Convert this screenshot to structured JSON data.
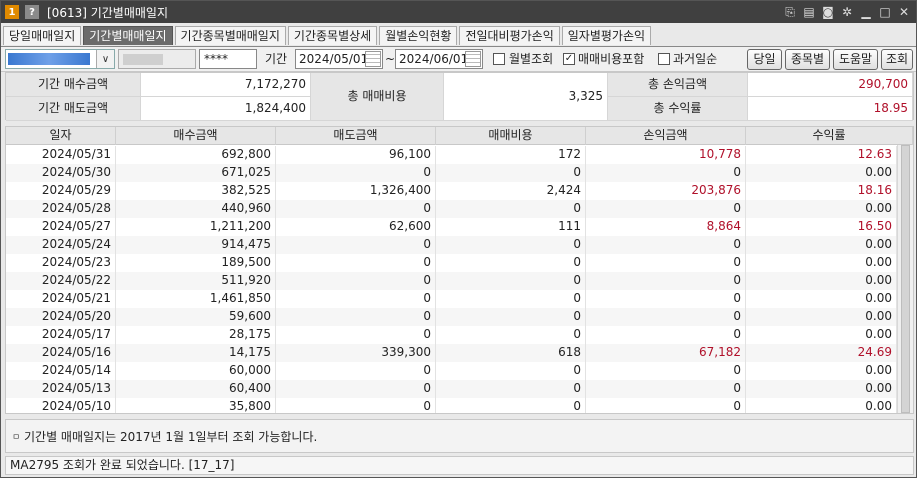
{
  "window": {
    "badge_one": "1",
    "badge_q": "?",
    "title": "[0613] 기간별매매일지"
  },
  "tabs": [
    {
      "label": "당일매매일지",
      "active": false
    },
    {
      "label": "기간별매매일지",
      "active": true
    },
    {
      "label": "기간종목별매매일지",
      "active": false
    },
    {
      "label": "기간종목별상세",
      "active": false
    },
    {
      "label": "월별손익현황",
      "active": false
    },
    {
      "label": "전일대비평가손익",
      "active": false
    },
    {
      "label": "일자별평가손익",
      "active": false
    }
  ],
  "filter": {
    "password": "****",
    "period_label": "기간",
    "start_date": "2024/05/01",
    "tilde": "~",
    "end_date": "2024/06/01",
    "monthly_label": "월별조회",
    "monthly_checked": false,
    "include_fee_label": "매매비용포함",
    "include_fee_checked": true,
    "past_order_label": "과거일순",
    "past_order_checked": false,
    "btn_today": "당일",
    "btn_by_stock": "종목별",
    "btn_help": "도움말",
    "btn_query": "조회"
  },
  "summary": {
    "buy_label": "기간 매수금액",
    "buy_value": "7,172,270",
    "sell_label": "기간 매도금액",
    "sell_value": "1,824,400",
    "fee_label": "총 매매비용",
    "fee_value": "3,325",
    "pnl_label": "총 손익금액",
    "pnl_value": "290,700",
    "return_label": "총 수익률",
    "return_value": "18.95"
  },
  "grid": {
    "headers": [
      "일자",
      "매수금액",
      "매도금액",
      "매매비용",
      "손익금액",
      "수익률"
    ],
    "rows": [
      [
        "2024/05/31",
        "692,800",
        "96,100",
        "172",
        "10,778",
        "12.63"
      ],
      [
        "2024/05/30",
        "671,025",
        "0",
        "0",
        "0",
        "0.00"
      ],
      [
        "2024/05/29",
        "382,525",
        "1,326,400",
        "2,424",
        "203,876",
        "18.16"
      ],
      [
        "2024/05/28",
        "440,960",
        "0",
        "0",
        "0",
        "0.00"
      ],
      [
        "2024/05/27",
        "1,211,200",
        "62,600",
        "111",
        "8,864",
        "16.50"
      ],
      [
        "2024/05/24",
        "914,475",
        "0",
        "0",
        "0",
        "0.00"
      ],
      [
        "2024/05/23",
        "189,500",
        "0",
        "0",
        "0",
        "0.00"
      ],
      [
        "2024/05/22",
        "511,920",
        "0",
        "0",
        "0",
        "0.00"
      ],
      [
        "2024/05/21",
        "1,461,850",
        "0",
        "0",
        "0",
        "0.00"
      ],
      [
        "2024/05/20",
        "59,600",
        "0",
        "0",
        "0",
        "0.00"
      ],
      [
        "2024/05/17",
        "28,175",
        "0",
        "0",
        "0",
        "0.00"
      ],
      [
        "2024/05/16",
        "14,175",
        "339,300",
        "618",
        "67,182",
        "24.69"
      ],
      [
        "2024/05/14",
        "60,000",
        "0",
        "0",
        "0",
        "0.00"
      ],
      [
        "2024/05/13",
        "60,400",
        "0",
        "0",
        "0",
        "0.00"
      ],
      [
        "2024/05/10",
        "35,800",
        "0",
        "0",
        "0",
        "0.00"
      ]
    ]
  },
  "notice": {
    "bullet": "ㅁ",
    "text": "기간별 매매일지는 2017년 1월 1일부터 조회 가능합니다."
  },
  "status": {
    "text": "MA2795 조회가 완료 되었습니다. [17_17]"
  },
  "colors": {
    "profit": "#b0102a",
    "active_tab": "#6b6b6b",
    "titlebar": "#404040"
  }
}
